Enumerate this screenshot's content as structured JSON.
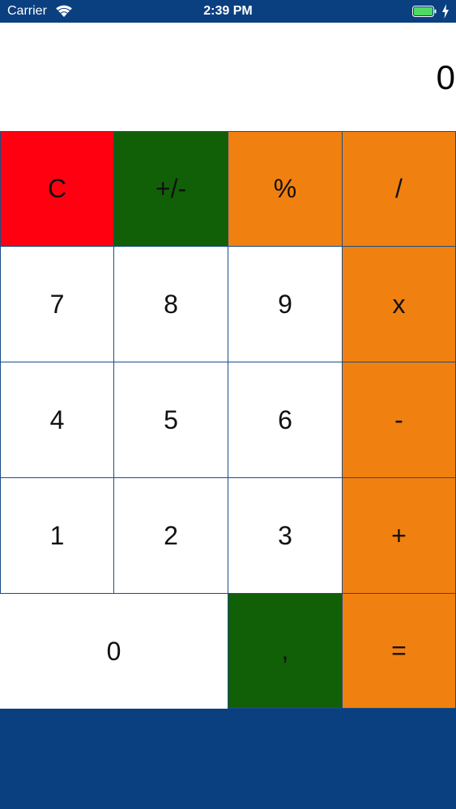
{
  "status_bar": {
    "carrier": "Carrier",
    "time": "2:39 PM",
    "wifi_icon": "wifi-icon",
    "battery_icon": "battery-icon",
    "charging_icon": "charging-bolt-icon",
    "battery_color": "#4cd964"
  },
  "display": {
    "value": "0"
  },
  "colors": {
    "background": "#0a3f80",
    "clear": "#ff0010",
    "sign": "#116008",
    "operator": "#f08010",
    "number": "#ffffff",
    "decimal": "#116008",
    "grid_line": "#1a4e86"
  },
  "keys": {
    "clear": "C",
    "sign": "+/-",
    "percent": "%",
    "divide": "/",
    "seven": "7",
    "eight": "8",
    "nine": "9",
    "multiply": "x",
    "four": "4",
    "five": "5",
    "six": "6",
    "minus": "-",
    "one": "1",
    "two": "2",
    "three": "3",
    "plus": "+",
    "zero": "0",
    "decimal": ",",
    "equals": "="
  }
}
